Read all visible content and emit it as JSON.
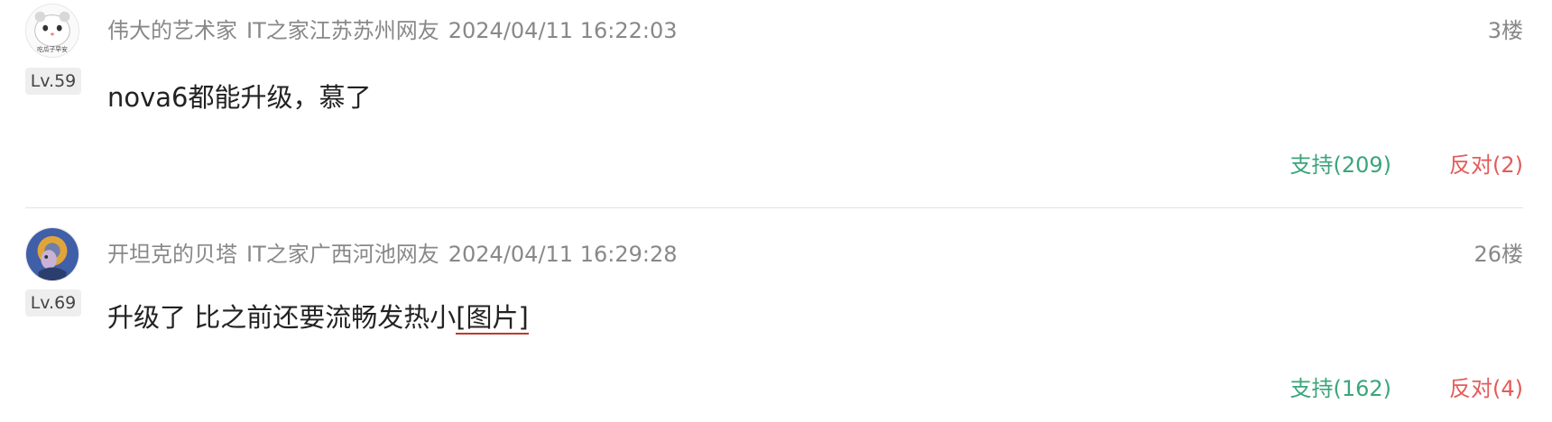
{
  "comments": [
    {
      "username": "伟大的艺术家",
      "location": "IT之家江苏苏州网友",
      "datetime": "2024/04/11 16:22:03",
      "floor": "3楼",
      "level": "Lv.59",
      "content_text": "nova6都能升级，慕了",
      "support_label": "支持(209)",
      "oppose_label": "反对(2)",
      "avatar_icon": "hamster-avatar-icon",
      "avatar_text": "吃瓜子早安"
    },
    {
      "username": "开坦克的贝塔",
      "location": "IT之家广西河池网友",
      "datetime": "2024/04/11 16:29:28",
      "floor": "26楼",
      "level": "Lv.69",
      "content_text": "升级了 比之前还要流畅发热小",
      "image_link_label": "[图片]",
      "support_label": "支持(162)",
      "oppose_label": "反对(4)",
      "avatar_icon": "cartoon-character-avatar-icon"
    }
  ],
  "colors": {
    "support": "#3aa57a",
    "oppose": "#e55a5a",
    "meta": "#888888",
    "link_underline": "#c0392b"
  }
}
